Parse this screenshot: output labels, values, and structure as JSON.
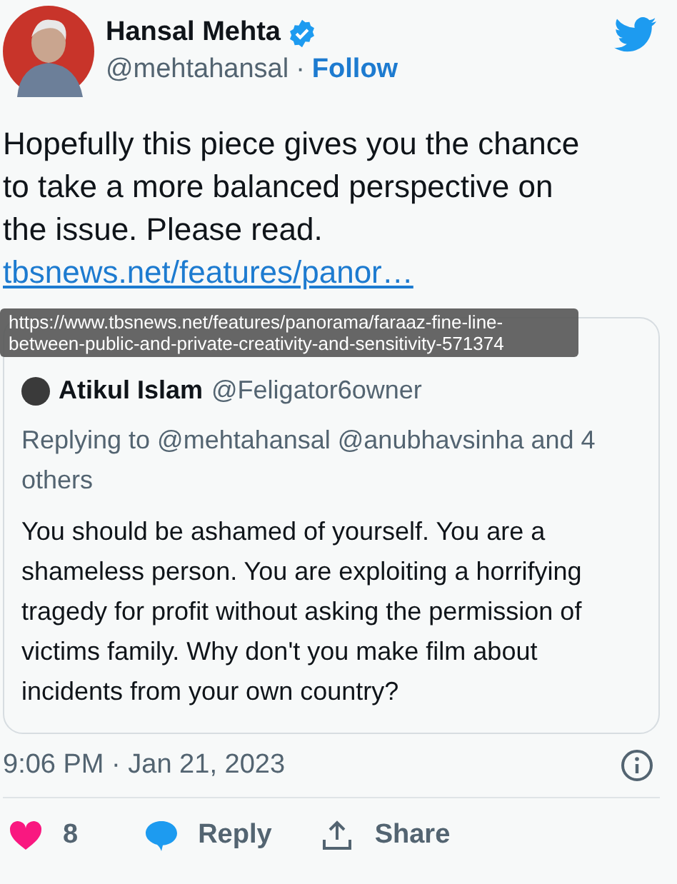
{
  "author": {
    "name": "Hansal Mehta",
    "verified": true,
    "handle": "@mehtahansal",
    "separator": "·",
    "follow": "Follow"
  },
  "tweet": {
    "text": "Hopefully this piece gives you the chance to take a more balanced perspective on the issue. Please read.",
    "link": "tbsnews.net/features/panor…"
  },
  "tooltip": {
    "text": "https://www.tbsnews.net/features/panorama/faraaz-fine-line-between-public-and-private-creativity-and-sensitivity-571374"
  },
  "quoted": {
    "name": "Atikul Islam",
    "handle": "@Feligator6owner",
    "replying": "Replying to @mehtahansal @anubhavsinha and 4 others",
    "text": "You should be ashamed of yourself. You are a shameless person. You are exploiting a horrifying tragedy for profit without asking the permission of victims family. Why don't you make film about incidents from your own country?"
  },
  "timestamp": "9:06 PM · Jan 21, 2023",
  "actions": {
    "likes": "8",
    "reply": "Reply",
    "share": "Share"
  }
}
